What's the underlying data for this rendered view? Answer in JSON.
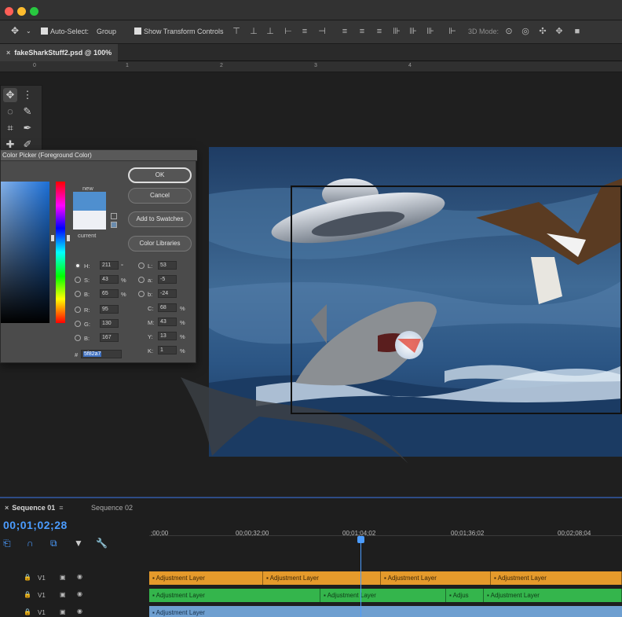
{
  "window": {
    "traffic_lights": [
      "#fe5f57",
      "#febc2e",
      "#28c840"
    ]
  },
  "options_bar": {
    "auto_select_label": "Auto-Select:",
    "auto_select_value": "Group",
    "show_transform_label": "Show Transform Controls",
    "mode_3d_label": "3D Mode:"
  },
  "document": {
    "tab_title": "fakeSharkStuff2.psd @ 100%"
  },
  "ruler": {
    "marks": [
      "0",
      "1",
      "2",
      "3",
      "4"
    ]
  },
  "color_picker": {
    "title": "Color Picker (Foreground Color)",
    "new_label": "new",
    "current_label": "current",
    "ok_label": "OK",
    "cancel_label": "Cancel",
    "add_swatches_label": "Add to Swatches",
    "color_libraries_label": "Color Libraries",
    "hsb": [
      {
        "label": "H:",
        "value": "211",
        "unit": "°"
      },
      {
        "label": "S:",
        "value": "43",
        "unit": "%"
      },
      {
        "label": "B:",
        "value": "65",
        "unit": "%"
      }
    ],
    "rgb": [
      {
        "label": "R:",
        "value": "95",
        "unit": ""
      },
      {
        "label": "G:",
        "value": "130",
        "unit": ""
      },
      {
        "label": "B:",
        "value": "167",
        "unit": ""
      }
    ],
    "lab": [
      {
        "label": "L:",
        "value": "53",
        "unit": ""
      },
      {
        "label": "a:",
        "value": "-5",
        "unit": ""
      },
      {
        "label": "b:",
        "value": "-24",
        "unit": ""
      }
    ],
    "cmyk": [
      {
        "label": "C:",
        "value": "68",
        "unit": "%"
      },
      {
        "label": "M:",
        "value": "43",
        "unit": "%"
      },
      {
        "label": "Y:",
        "value": "13",
        "unit": "%"
      },
      {
        "label": "K:",
        "value": "1",
        "unit": "%"
      }
    ],
    "hex_label": "#",
    "hex_value": "5f82a7",
    "colors": {
      "new": "#4f8fcf",
      "current": "#eef0f5"
    }
  },
  "timeline": {
    "tabs": [
      "Sequence 01",
      "Sequence 02"
    ],
    "timecode": "00;01;02;28",
    "ruler_times": [
      ";00;00",
      "00;00;32;00",
      "00;01;04;02",
      "00;01;36;02",
      "00;02;08;04"
    ],
    "tracks": [
      {
        "name": "V1",
        "clips": [
          "Adjustment Layer",
          "Adjustment Layer",
          "Adjustment Layer",
          "Adjustment Layer"
        ]
      },
      {
        "name": "V1",
        "clips": [
          "Adjustment Layer",
          "Adjustment Layer",
          "Adjus",
          "Adjustment Layer"
        ]
      },
      {
        "name": "V1",
        "clips": [
          "Adjustment Layer"
        ]
      }
    ],
    "colors": {
      "playhead": "#4b9cff",
      "orange": "#e59a2b",
      "green": "#34b54c",
      "blue": "#6e9fd0"
    }
  }
}
